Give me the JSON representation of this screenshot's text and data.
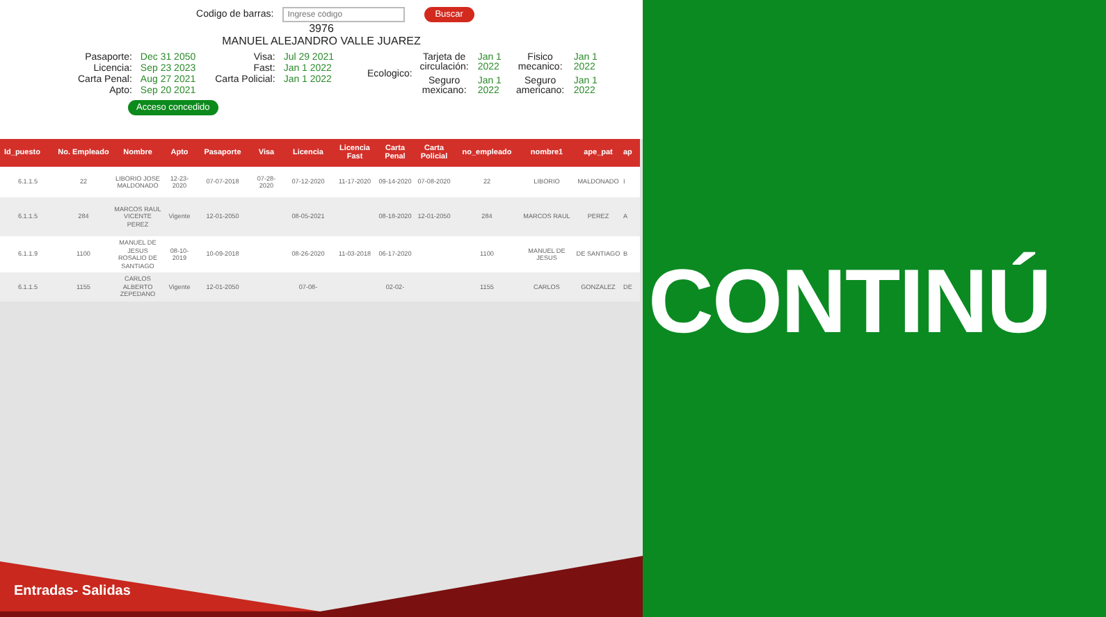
{
  "search": {
    "label": "Codigo de barras:",
    "placeholder": "Ingrese código",
    "button": "Buscar"
  },
  "employee": {
    "number": "3976",
    "name": "MANUEL ALEJANDRO VALLE JUAREZ"
  },
  "documents_left": [
    [
      {
        "label": "Pasaporte:",
        "value": "Dec 31 2050"
      },
      {
        "label": "Licencia:",
        "value": "Sep 23 2023"
      },
      {
        "label": "Carta Penal:",
        "value": "Aug 27 2021"
      },
      {
        "label": "Apto:",
        "value": "Sep 20 2021"
      }
    ],
    [
      {
        "label": "Visa:",
        "value": "Jul 29 2021"
      },
      {
        "label": "Fast:",
        "value": "Jan 1 2022"
      },
      {
        "label": "Carta Policial:",
        "value": "Jan 1 2022"
      }
    ]
  ],
  "documents_right": [
    [
      {
        "label": "Tarjeta de circulación:",
        "value": "Jan 1 2022"
      },
      {
        "label": "Fisico mecanico:",
        "value": "Jan 1 2022"
      }
    ],
    [
      {
        "label": "Seguro mexicano:",
        "value": "Jan 1 2022"
      },
      {
        "label": "Seguro americano:",
        "value": "Jan 1 2022"
      }
    ]
  ],
  "ecologico": {
    "label": "Ecologico:"
  },
  "access": {
    "label": "Acceso concedido",
    "granted": true
  },
  "table": {
    "columns": [
      "Id_puesto",
      "No. Empleado",
      "Nombre",
      "Apto",
      "Pasaporte",
      "Visa",
      "Licencia",
      "Licencia Fast",
      "Carta Penal",
      "Carta Policial",
      "no_empleado",
      "nombre1",
      "ape_pat",
      "ap"
    ],
    "rows": [
      [
        "6.1.1.5",
        "22",
        "LIBORIO JOSE MALDONADO",
        "12-23-2020",
        "07-07-2018",
        "07-28-2020",
        "07-12-2020",
        "11-17-2020",
        "09-14-2020",
        "07-08-2020",
        "22",
        "LIBORIO",
        "MALDONADO",
        "I"
      ],
      [
        "6.1.1.5",
        "284",
        "MARCOS RAUL VICENTE PEREZ",
        "Vigente",
        "12-01-2050",
        "",
        "08-05-2021",
        "",
        "08-18-2020",
        "12-01-2050",
        "284",
        "MARCOS RAUL",
        "PEREZ",
        "A"
      ],
      [
        "6.1.1.9",
        "1100",
        "MANUEL DE JESUS ROSALIO DE SANTIAGO",
        "08-10-2019",
        "10-09-2018",
        "",
        "08-26-2020",
        "11-03-2018",
        "06-17-2020",
        "",
        "1100",
        "MANUEL DE JESUS",
        "DE SANTIAGO",
        "B"
      ],
      [
        "6.1.1.5",
        "1155",
        "CARLOS ALBERTO ZEPEDANO",
        "Vigente",
        "12-01-2050",
        "",
        "07-08-",
        "",
        "02-02-",
        "",
        "1155",
        "CARLOS",
        "GONZALEZ",
        "DE"
      ]
    ]
  },
  "footer": {
    "title": "Entradas- Salidas"
  },
  "banner": {
    "text": "CONTINÚ"
  }
}
